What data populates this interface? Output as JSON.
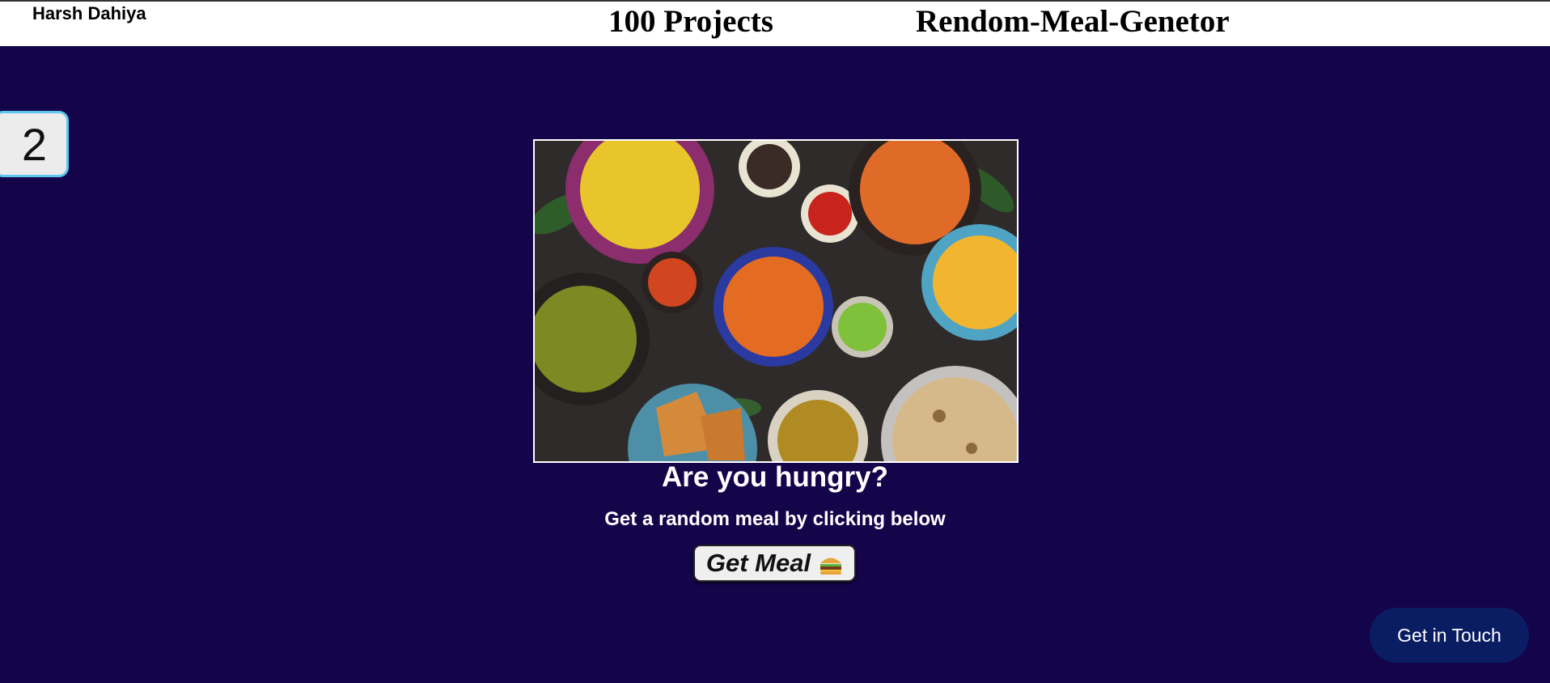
{
  "header": {
    "author": "Harsh Dahiya",
    "projects_title": "100 Projects",
    "app_title": "Rendom-Meal-Genetor"
  },
  "project_number": "2",
  "hero": {
    "headline": "Are you hungry?",
    "subtitle": "Get a random meal by clicking below"
  },
  "get_meal_button": {
    "label": "Get Meal",
    "icon": "burger-icon"
  },
  "contact_button": {
    "label": "Get in Touch"
  },
  "colors": {
    "page_background": "#14044a",
    "header_background": "#ffffff",
    "badge_border": "#5fc6ee",
    "contact_button": "#0a1d63"
  }
}
